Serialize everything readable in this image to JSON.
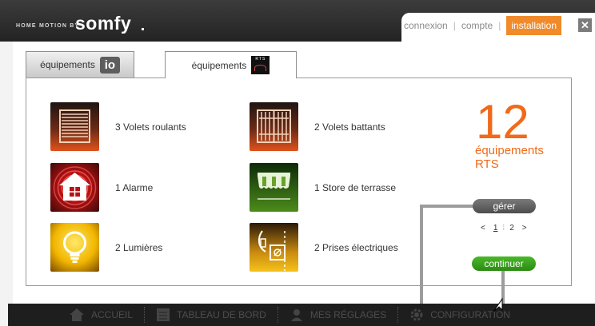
{
  "brand": {
    "small": "HOME MOTION BY",
    "name": "somfy"
  },
  "topnav": {
    "items": [
      "connexion",
      "compte",
      "installation"
    ],
    "active": "installation",
    "close": "✕"
  },
  "tabs": {
    "io": {
      "label": "équipements",
      "badge": "io"
    },
    "rts": {
      "label": "équipements",
      "badge": "RTS"
    }
  },
  "equipment": [
    {
      "label": "3 Volets roulants",
      "icon": "roller-shutter-icon"
    },
    {
      "label": "2 Volets battants",
      "icon": "swing-shutter-icon"
    },
    {
      "label": "1 Alarme",
      "icon": "alarm-house-icon"
    },
    {
      "label": "1 Store de terrasse",
      "icon": "awning-icon"
    },
    {
      "label": "2 Lumières",
      "icon": "light-bulb-icon"
    },
    {
      "label": "2 Prises électriques",
      "icon": "power-plug-icon"
    }
  ],
  "summary": {
    "count": "12",
    "label_line1": "équipements",
    "label_line2": "RTS"
  },
  "actions": {
    "manage": "gérer",
    "continue": "continuer"
  },
  "pager": {
    "prev": "<",
    "pages": [
      "1",
      "2"
    ],
    "current": "1",
    "next": ">"
  },
  "bottom_nav": [
    {
      "label": "ACCUEIL",
      "icon": "home-icon"
    },
    {
      "label": "TABLEAU DE BORD",
      "icon": "dashboard-icon"
    },
    {
      "label": "MES RÉGLAGES",
      "icon": "user-icon"
    },
    {
      "label": "CONFIGURATION",
      "icon": "gear-icon"
    }
  ],
  "colors": {
    "accent_orange": "#f06a1a",
    "active_tab": "#f08a2a",
    "continue_green": "#3da31f"
  }
}
